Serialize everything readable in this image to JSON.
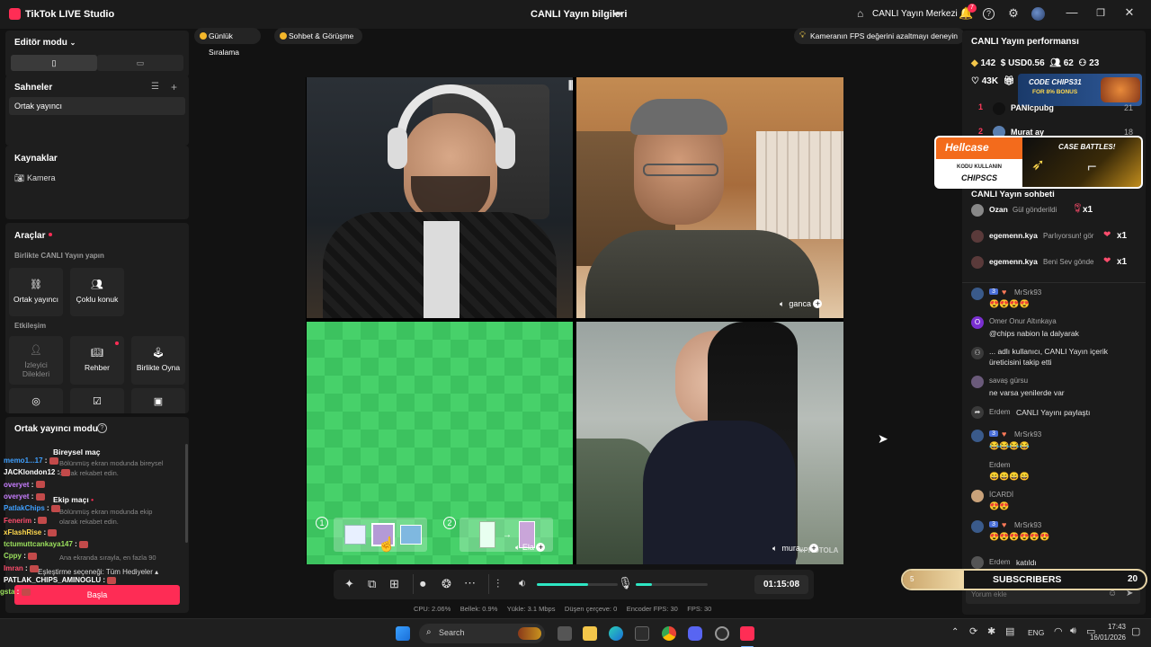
{
  "titlebar": {
    "app_name": "TikTok LIVE Studio",
    "center_title": "CANLI Yayın bilgileri",
    "live_center": "CANLI Yayın Merkezi",
    "notification_count": "7"
  },
  "left": {
    "editor_mode": "Editör modu",
    "scenes_title": "Sahneler",
    "scene_item": "Ortak yayıncı",
    "sources_title": "Kaynaklar",
    "source_item": "Kamera",
    "tools_title": "Araçlar",
    "birlikte_label": "Birlikte CANLI Yayın yapın",
    "tool_cohost": "Ortak yayıncı",
    "tool_multiguest": "Çoklu konuk",
    "interaction_label": "Etkileşim",
    "tool_viewer_1": "İzleyici",
    "tool_viewer_2": "Dilekleri",
    "tool_guide": "Rehber",
    "tool_play": "Birlikte Oyna",
    "cohost_mode": "Ortak yayıncı modu",
    "individual_match": "Bireysel maç",
    "individual_desc_1": "Bölünmüş ekran modunda bireysel",
    "individual_desc_2": "olarak rekabet edin.",
    "team_match": "Ekip maçı",
    "team_desc_1": "Bölünmüş ekran modunda ekip",
    "team_desc_2": "olarak rekabet edin.",
    "rank_desc": "Ana ekranda sırayla, en fazla 90",
    "gift_setting": "Eşleştirme seçeneği: Tüm Hediyeler",
    "start_button": "Başla"
  },
  "overlay_chat": [
    {
      "name": "memo1...17",
      "color": "#3fa0ff"
    },
    {
      "name": "JACKlondon12",
      "color": "#ffffff"
    },
    {
      "name": "overyet",
      "color": "#c77dff"
    },
    {
      "name": "overyet",
      "color": "#c77dff"
    },
    {
      "name": "PatlakChips",
      "color": "#3fa0ff"
    },
    {
      "name": "Fenerim",
      "color": "#ff4d6d"
    },
    {
      "name": "xFlashRise",
      "color": "#ffd84d"
    },
    {
      "name": "tctumuttcankaya147",
      "color": "#9be15d"
    },
    {
      "name": "Cppy",
      "color": "#9be15d"
    },
    {
      "name": "Imran",
      "color": "#ff4d6d"
    },
    {
      "name": "PATLAK_CHIPS_AMINOGLU",
      "color": "#ffffff"
    },
    {
      "name": "gsta",
      "color": "#9be15d"
    }
  ],
  "center": {
    "pill_ranking": "Günlük Sıralama",
    "pill_chat": "Sohbet & Görüşme",
    "fps_tip": "Kameranın FPS değerini azaltmayı deneyin",
    "tile_name_top_right": "ganca",
    "tile_name_bottom_left": "Ela",
    "tile_name_bottom_right": "mura...",
    "watermark": "#PHOTOLA",
    "step1": "1",
    "step2": "2",
    "timer": "01:15:08"
  },
  "stats": {
    "cpu": "CPU:  2.06%",
    "memory": "Bellek:  0.9%",
    "upload": "Yükle:  3.1 Mbps",
    "dropped": "Düşen çerçeve:  0",
    "encoder": "Encoder FPS:  30",
    "fps": "FPS:  30"
  },
  "right": {
    "perf_title": "CANLI Yayın performansı",
    "diamonds": "142",
    "usd": "USD0.56",
    "viewers": "62",
    "followers": "23",
    "likes": "43K",
    "rank1_num": "1",
    "rank1_name": "PANIcpubg",
    "rank1_val": "21",
    "rank2_num": "2",
    "rank2_name": "Murat ay",
    "rank2_val": "18",
    "ad1_code": "CODE CHIPS31",
    "ad1_bonus": "FOR 8% BONUS",
    "ad2_brand": "Hellcase",
    "ad2_line1": "KODU KULLANIN",
    "ad2_code": "CHIPSCS",
    "ad2_battles": "CASE BATTLES!",
    "chat_title": "CANLI Yayın sohbeti",
    "gift1_name": "Ozan",
    "gift1_text": "Gül gönderildi",
    "gift1_count": "x1",
    "gift2_name": "egemenn.kya",
    "gift2_text": "Parlıyorsun! gör",
    "gift2_count": "x1",
    "gift3_name": "egemenn.kya",
    "gift3_text": "Beni Sev gönde",
    "gift3_count": "x1",
    "c1_level": "3",
    "c1_name": "MrSrk93",
    "c2_name": "Omer Onur Altınkaya",
    "c2_text": "@chips nabion la dalyarak",
    "c3_text_1": "... adlı kullanıcı, CANLI Yayın içerik",
    "c3_text_2": "üreticisini takip etti",
    "c4_name": "savaş gürsu",
    "c4_text": "ne varsa yenilerde var",
    "c5_name": "Erdem",
    "c5_text": "CANLI Yayını paylaştı",
    "c6_level": "3",
    "c6_name": "MrSrk93",
    "c7_name": "Erdem",
    "c8_name": "İCARDİ",
    "c9_level": "3",
    "c9_name": "MrSrk93",
    "c10_name": "Erdem",
    "c10_text": "katıldı",
    "subs_current": "5",
    "subs_label": "SUBSCRIBERS",
    "subs_goal": "20",
    "subs_progress": 0.25,
    "comment_placeholder": "Yorum ekle"
  },
  "taskbar": {
    "search": "Search",
    "lang": "ENG",
    "time": "17:43",
    "date": "16/01/2026"
  }
}
